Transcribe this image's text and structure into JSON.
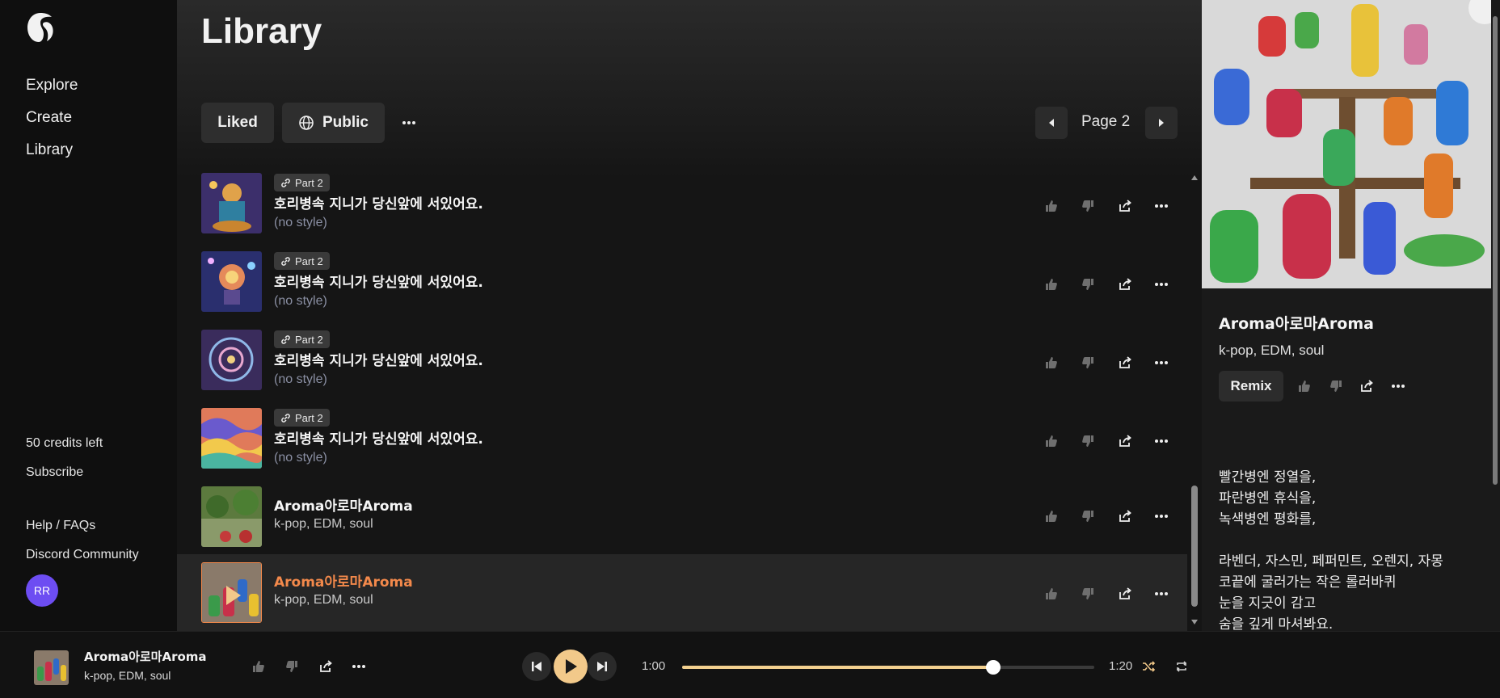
{
  "colors": {
    "accent": "#f3894b",
    "play": "#f2c98a",
    "progress": "#f2d08f",
    "avatar": "#6d4df2"
  },
  "sidebar": {
    "logo": "suno-logo",
    "nav": [
      {
        "label": "Explore"
      },
      {
        "label": "Create"
      },
      {
        "label": "Library"
      }
    ],
    "credits": "50 credits left",
    "subscribe": "Subscribe",
    "help": "Help / FAQs",
    "discord": "Discord Community",
    "avatar_initials": "RR"
  },
  "main": {
    "title": "Library",
    "filters": {
      "liked": "Liked",
      "public": "Public",
      "more_icon": "ellipsis-icon"
    },
    "pager": {
      "label": "Page 2"
    },
    "rows": [
      {
        "badge": "Part 2",
        "title": "호리병속 지니가 당신앞에 서있어요.",
        "subtitle": "(no style)",
        "thumb": "genie-art"
      },
      {
        "badge": "Part 2",
        "title": "호리병속 지니가 당신앞에 서있어요.",
        "subtitle": "(no style)",
        "thumb": "cosmic-art"
      },
      {
        "badge": "Part 2",
        "title": "호리병속 지니가 당신앞에 서있어요.",
        "subtitle": "(no style)",
        "thumb": "mandala-art"
      },
      {
        "badge": "Part 2",
        "title": "호리병속 지니가 당신앞에 서있어요.",
        "subtitle": "(no style)",
        "thumb": "swirl-art"
      },
      {
        "badge": "",
        "title": "Aroma아로마Aroma",
        "subtitle": "k-pop, EDM, soul",
        "thumb": "garden-art"
      },
      {
        "badge": "",
        "title": "Aroma아로마Aroma",
        "subtitle": "k-pop, EDM, soul",
        "thumb": "bottles-art",
        "active": true
      }
    ]
  },
  "right_panel": {
    "title": "Aroma아로마Aroma",
    "tags": "k-pop, EDM, soul",
    "remix": "Remix",
    "lyrics": "빨간병엔 정열을,\n파란병엔 휴식을,\n녹색병엔 평화를,\n\n라벤더, 자스민, 페퍼민트, 오렌지, 자몽\n코끝에 굴러가는 작은 롤러바퀴\n눈을 지긋이 감고\n숨을 깊게 마셔봐요."
  },
  "player": {
    "title": "Aroma아로마Aroma",
    "subtitle": "k-pop, EDM, soul",
    "current_time": "1:00",
    "total_time": "1:20",
    "progress": 0.755
  }
}
